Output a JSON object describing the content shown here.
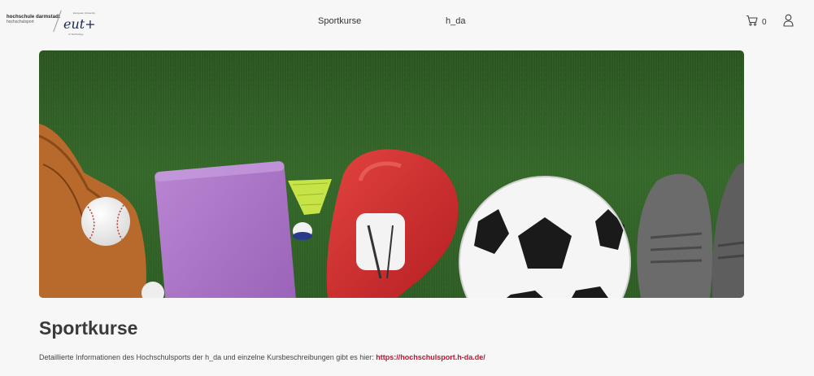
{
  "header": {
    "logo_line1": "hochschule darmstadt",
    "logo_line2": "hochschulsport",
    "partner_logo_text": "eut+",
    "partner_logo_small": "European University",
    "partner_logo_tag": "of Technology",
    "nav": [
      {
        "label": "Sportkurse"
      },
      {
        "label": "h_da"
      }
    ],
    "cart_count": "0",
    "icons": {
      "cart": "shopping-cart-icon",
      "user": "user-icon"
    }
  },
  "hero": {
    "image": "sports-equipment-on-grass",
    "grass_color": "#2f5a25"
  },
  "main": {
    "title": "Sportkurse",
    "description": "Detaillierte Informationen des Hochschulsports der h_da und einzelne Kursbeschreibungen gibt es hier: ",
    "link_text": "https://hochschulsport.h-da.de/"
  },
  "colors": {
    "link": "#c8102e",
    "background": "#f7f7f7"
  }
}
